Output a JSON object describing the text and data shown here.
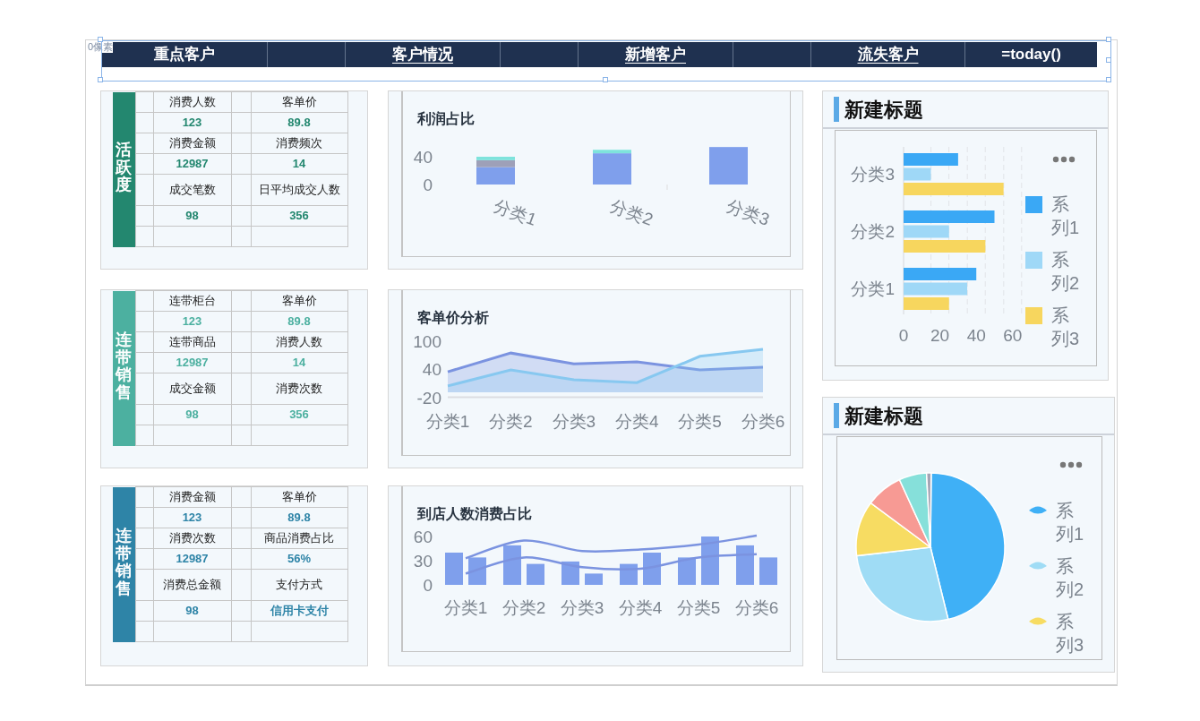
{
  "canvas_label": "0像素",
  "header": [
    {
      "kind": "text",
      "text": "重点客户",
      "underlined": false
    },
    {
      "kind": "blank"
    },
    {
      "kind": "text",
      "text": "客户情况",
      "underlined": true
    },
    {
      "kind": "blank"
    },
    {
      "kind": "text",
      "text": "新增客户",
      "underlined": true
    },
    {
      "kind": "blank"
    },
    {
      "kind": "text",
      "text": "流失客户",
      "underlined": true
    },
    {
      "kind": "text",
      "text": "=today()",
      "underlined": false
    }
  ],
  "kpi_panels": [
    {
      "label": "活跃度",
      "color": "#23876f",
      "rows": [
        {
          "kind": "label",
          "cells": [
            "消费人数",
            "客单价"
          ]
        },
        {
          "kind": "value",
          "cells": [
            "123",
            "89.8"
          ]
        },
        {
          "kind": "label",
          "cells": [
            "消费金额",
            "消费频次"
          ]
        },
        {
          "kind": "value",
          "cells": [
            "12987",
            "14"
          ]
        },
        {
          "kind": "label",
          "cells": [
            "成交笔数",
            "日平均成交人数"
          ]
        },
        {
          "kind": "value",
          "cells": [
            "98",
            "356"
          ]
        }
      ]
    },
    {
      "label": "连带销售",
      "color": "#4cb0a0",
      "rows": [
        {
          "kind": "label",
          "cells": [
            "连带柜台",
            "客单价"
          ]
        },
        {
          "kind": "value",
          "cells": [
            "123",
            "89.8"
          ]
        },
        {
          "kind": "label",
          "cells": [
            "连带商品",
            "消费人数"
          ]
        },
        {
          "kind": "value",
          "cells": [
            "12987",
            "14"
          ]
        },
        {
          "kind": "label",
          "cells": [
            "成交金额",
            "消费次数"
          ]
        },
        {
          "kind": "value",
          "cells": [
            "98",
            "356"
          ]
        }
      ]
    },
    {
      "label": "连带销售",
      "color": "#2e84a7",
      "rows": [
        {
          "kind": "label",
          "cells": [
            "消费金额",
            "客单价"
          ]
        },
        {
          "kind": "value",
          "cells": [
            "123",
            "89.8"
          ]
        },
        {
          "kind": "label",
          "cells": [
            "消费次数",
            "商品消费占比"
          ]
        },
        {
          "kind": "value",
          "cells": [
            "12987",
            "56%"
          ]
        },
        {
          "kind": "label",
          "cells": [
            "消费总金额",
            "支付方式"
          ]
        },
        {
          "kind": "value",
          "cells": [
            "98",
            "信用卡支付"
          ]
        }
      ]
    }
  ],
  "charts": [
    {
      "title": "利润占比",
      "chart_data": {
        "type": "bar",
        "stacked": true,
        "categories": [
          "分类1",
          "分类2",
          "分类3"
        ],
        "ylim": [
          0,
          54
        ],
        "yticks": [
          0,
          40
        ],
        "series": [
          {
            "color": "#7f9fec",
            "values": [
              25,
              45,
              54
            ]
          },
          {
            "color": "#9ea0b8",
            "values": [
              10,
              0,
              0
            ]
          },
          {
            "color": "#7ee3dc",
            "values": [
              5,
              5,
              0
            ]
          }
        ]
      }
    },
    {
      "title": "客单价分析",
      "chart_data": {
        "type": "area",
        "categories": [
          "分类1",
          "分类2",
          "分类3",
          "分类4",
          "分类5",
          "分类6"
        ],
        "ylim": [
          -20,
          100
        ],
        "yticks": [
          -20,
          40,
          100
        ],
        "series": [
          {
            "type": "area",
            "color": "#7b93e0",
            "values": [
              34,
              74,
              51,
              55,
              38,
              44
            ]
          },
          {
            "type": "area",
            "color": "#87c8f0",
            "values": [
              4,
              38,
              17,
              11,
              67,
              82
            ]
          }
        ]
      }
    },
    {
      "title": "到店人数消费占比",
      "chart_data": {
        "type": "bar",
        "stacked": false,
        "categories": [
          "分类1",
          "分类2",
          "分类3",
          "分类4",
          "分类5",
          "分类6"
        ],
        "ylim": [
          0,
          64
        ],
        "yticks": [
          0,
          30,
          60
        ],
        "series": [
          {
            "type": "bar",
            "color": "#7f9fec",
            "values": [
              40,
              49,
              29,
              26,
              34,
              49
            ]
          },
          {
            "type": "bar",
            "color": "#7f9fec",
            "values": [
              34,
              26,
              14,
              40,
              60,
              34
            ]
          },
          {
            "type": "line",
            "color": "#7b93e0",
            "values": [
              33,
              55,
              42,
              44,
              50,
              61
            ]
          },
          {
            "type": "line",
            "color": "#7b93e0",
            "values": [
              14,
              34,
              22,
              20,
              34,
              38
            ]
          }
        ]
      }
    }
  ],
  "side_panels": [
    {
      "title": "新建标题",
      "chart_data": {
        "type": "bar",
        "orientation": "horizontal",
        "categories": [
          "分类3",
          "分类2",
          "分类1"
        ],
        "xlim": [
          0,
          60
        ],
        "xticks": [
          0,
          20,
          40,
          60
        ],
        "legend": true,
        "series": [
          {
            "name": "系列1",
            "color": "#3aa8f5",
            "values": [
              30,
              50,
              40
            ]
          },
          {
            "name": "系列2",
            "color": "#9fd8f7",
            "values": [
              15,
              25,
              35
            ]
          },
          {
            "name": "系列3",
            "color": "#f7d65e",
            "values": [
              55,
              45,
              25
            ]
          }
        ]
      }
    },
    {
      "title": "新建标题",
      "chart_data": {
        "type": "pie",
        "legend": true,
        "categories": [
          "系列1",
          "系列2",
          "系列3",
          null,
          null,
          null
        ],
        "values": [
          46,
          27,
          12,
          8,
          6,
          1
        ],
        "colors": [
          "#3fb0f6",
          "#9fdcf5",
          "#f7dc62",
          "#f79a94",
          "#86e0da",
          "#a4a4b4"
        ]
      }
    }
  ]
}
